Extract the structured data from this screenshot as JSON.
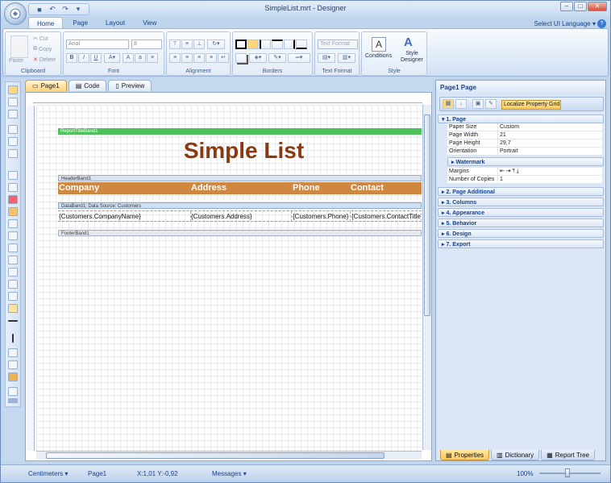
{
  "window": {
    "title": "SimpleList.mrt - Designer"
  },
  "ribbon": {
    "tabs": [
      "Home",
      "Page",
      "Layout",
      "View"
    ],
    "ui_language": "Select UI Language",
    "groups": {
      "clipboard": {
        "label": "Clipboard",
        "paste": "Paste",
        "cut": "Cut",
        "copy": "Copy",
        "delete": "Delete"
      },
      "font": {
        "label": "Font",
        "family": "Arial",
        "size": "8"
      },
      "alignment": {
        "label": "Alignment"
      },
      "borders": {
        "label": "Borders"
      },
      "text_format": {
        "label": "Text Format",
        "button": "Text Format"
      },
      "style": {
        "label": "Style",
        "conditions": "Conditions",
        "style_designer": "Style Designer"
      }
    }
  },
  "doc_tabs": [
    "Page1",
    "Code",
    "Preview"
  ],
  "report": {
    "bands": {
      "title": "ReportTitleBand1",
      "header": "HeaderBand1",
      "data": "DataBand1; Data Source: Customers",
      "footer": "FooterBand1"
    },
    "title_text": "Simple List",
    "columns": [
      "Company",
      "Address",
      "Phone",
      "Contact"
    ],
    "data_fields": [
      "{Customers.CompanyName}",
      "{Customers.Address}",
      "{Customers.Phone}",
      "{Customers.ContactTitle}"
    ]
  },
  "properties": {
    "header": "Page1 Page",
    "localize_button": "Localize Property Grid",
    "category_page": "1. Page",
    "rows": [
      {
        "name": "Paper Size",
        "value": "Custom"
      },
      {
        "name": "Page Width",
        "value": "21"
      },
      {
        "name": "Page Height",
        "value": "29,7"
      },
      {
        "name": "Orientation",
        "value": "Portrait"
      }
    ],
    "watermark": "Watermark",
    "margins": "Margins",
    "copies_name": "Number of Copies",
    "copies_value": "1",
    "categories": [
      "2. Page  Additional",
      "3. Columns",
      "4. Appearance",
      "5. Behavior",
      "6. Design",
      "7. Export"
    ]
  },
  "panel_tabs": [
    "Properties",
    "Dictionary",
    "Report Tree"
  ],
  "status": {
    "units": "Centimeters",
    "page": "Page1",
    "coords": "X:1,01  Y:-0,92",
    "messages": "Messages",
    "zoom": "100%"
  }
}
